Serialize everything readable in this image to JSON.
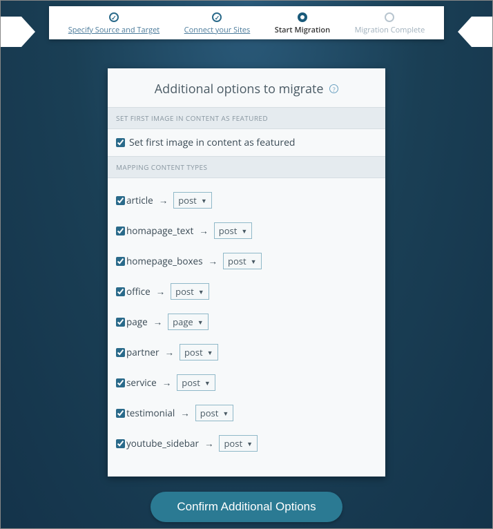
{
  "stepper": {
    "steps": [
      {
        "label": "Specify Source and Target",
        "state": "done"
      },
      {
        "label": "Connect your Sites",
        "state": "done"
      },
      {
        "label": "Start Migration",
        "state": "current"
      },
      {
        "label": "Migration Complete",
        "state": "pending"
      }
    ]
  },
  "card": {
    "title": "Additional options to migrate",
    "section_featured": {
      "header": "SET FIRST IMAGE IN CONTENT AS FEATURED",
      "checkbox_label": "Set first image in content as featured",
      "checked": true
    },
    "section_mapping": {
      "header": "MAPPING CONTENT TYPES",
      "rows": [
        {
          "name": "article",
          "value": "post",
          "checked": true
        },
        {
          "name": "homapage_text",
          "value": "post",
          "checked": true
        },
        {
          "name": "homepage_boxes",
          "value": "post",
          "checked": true
        },
        {
          "name": "office",
          "value": "post",
          "checked": true
        },
        {
          "name": "page",
          "value": "page",
          "checked": true
        },
        {
          "name": "partner",
          "value": "post",
          "checked": true
        },
        {
          "name": "service",
          "value": "post",
          "checked": true
        },
        {
          "name": "testimonial",
          "value": "post",
          "checked": true
        },
        {
          "name": "youtube_sidebar",
          "value": "post",
          "checked": true
        }
      ]
    }
  },
  "confirm_label": "Confirm Additional Options"
}
